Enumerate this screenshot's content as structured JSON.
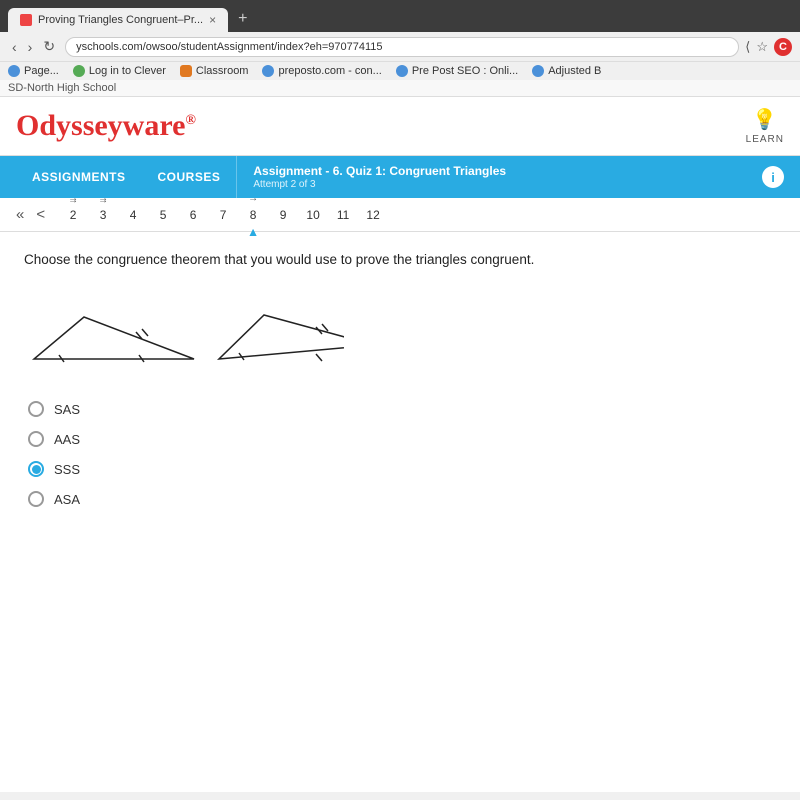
{
  "browser": {
    "tab_title": "Proving Triangles Congruent–Pr...",
    "tab_close": "×",
    "tab_plus": "+",
    "address": "yschools.com/owsoo/studentAssignment/index?eh=970774115",
    "back_btn": "‹",
    "forward_btn": "›",
    "reload_btn": "↻",
    "share_icon": "⟨",
    "star_icon": "☆",
    "c_icon": "C"
  },
  "bookmarks": [
    {
      "label": "Page...",
      "icon": "generic"
    },
    {
      "label": "Log in to Clever",
      "icon": "blue"
    },
    {
      "label": "Classroom",
      "icon": "orange"
    },
    {
      "label": "preposto.com - con...",
      "icon": "blue"
    },
    {
      "label": "Pre Post SEO : Onli...",
      "icon": "blue"
    },
    {
      "label": "Adjusted B",
      "icon": "blue"
    }
  ],
  "school": {
    "name": "SD-North High School"
  },
  "header": {
    "logo": "Odysseyware",
    "logo_reg": "®",
    "learn_label": "LEARN"
  },
  "navbar": {
    "assignments_label": "ASSIGNMENTS",
    "courses_label": "COURSES",
    "assignment_title": "Assignment  - 6. Quiz 1: Congruent Triangles",
    "assignment_sub": "Attempt 2 of 3",
    "info_icon": "i"
  },
  "pagination": {
    "double_back": "«",
    "single_back": "<",
    "pages": [
      {
        "num": "2",
        "arrow": true
      },
      {
        "num": "3",
        "arrow": true
      },
      {
        "num": "4",
        "arrow": false
      },
      {
        "num": "5",
        "arrow": false
      },
      {
        "num": "6",
        "arrow": false
      },
      {
        "num": "7",
        "arrow": false
      },
      {
        "num": "8",
        "arrow": true,
        "current": true
      },
      {
        "num": "9",
        "arrow": false
      },
      {
        "num": "10",
        "arrow": false
      },
      {
        "num": "11",
        "arrow": false
      },
      {
        "num": "12",
        "arrow": false
      }
    ]
  },
  "question": {
    "text": "Choose the congruence theorem that you would use to prove the triangles congruent.",
    "answers": [
      {
        "id": "sas",
        "label": "SAS",
        "selected": false
      },
      {
        "id": "aas",
        "label": "AAS",
        "selected": false
      },
      {
        "id": "sss",
        "label": "SSS",
        "selected": true
      },
      {
        "id": "asa",
        "label": "ASA",
        "selected": false
      }
    ]
  }
}
